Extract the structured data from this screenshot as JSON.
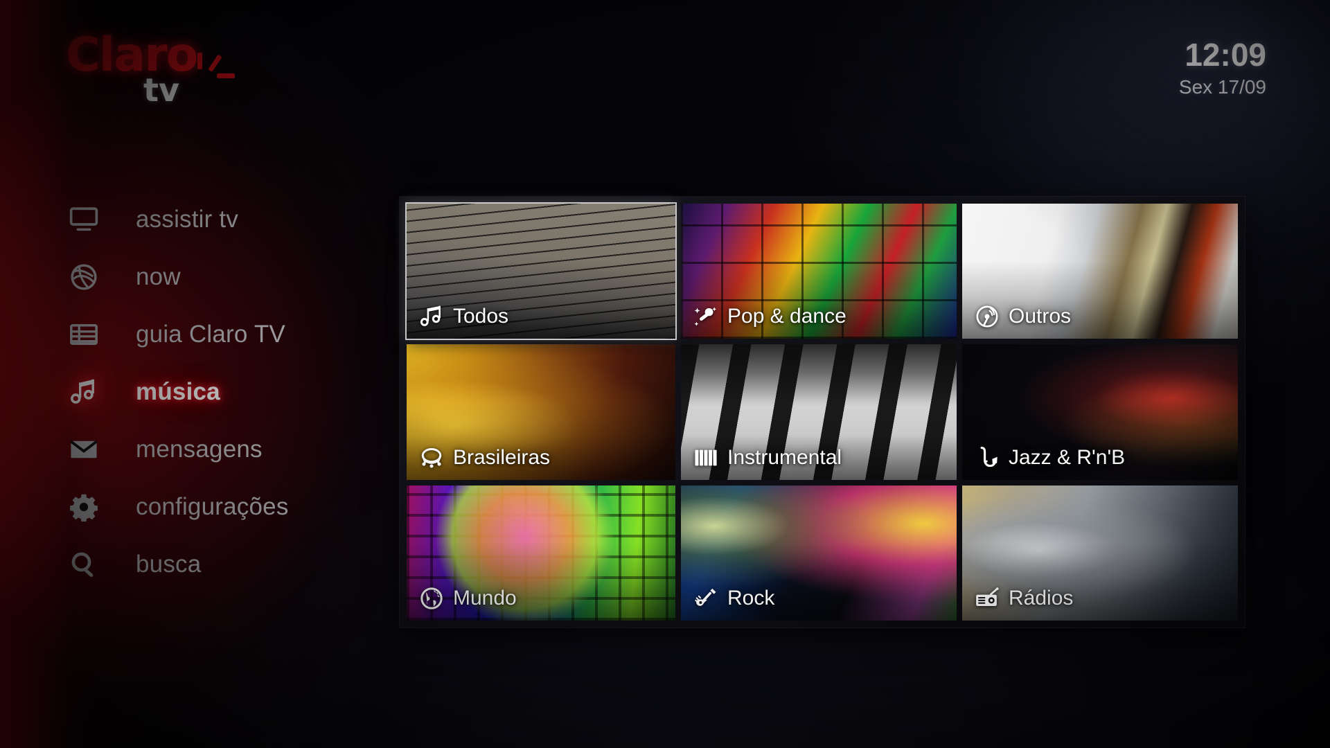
{
  "brand": {
    "name": "Claro",
    "suffix": "tv",
    "accent_color": "#e01118"
  },
  "clock": {
    "time": "12:09",
    "date": "Sex 17/09"
  },
  "sidebar": {
    "items": [
      {
        "id": "assistir-tv",
        "label": "assistir tv",
        "icon": "monitor-icon",
        "active": false
      },
      {
        "id": "now",
        "label": "now",
        "icon": "globe-mesh-icon",
        "active": false
      },
      {
        "id": "guia-claro-tv",
        "label": "guia Claro TV",
        "icon": "grid-list-icon",
        "active": false
      },
      {
        "id": "musica",
        "label": "música",
        "icon": "music-note-icon",
        "active": true
      },
      {
        "id": "mensagens",
        "label": "mensagens",
        "icon": "envelope-icon",
        "active": false
      },
      {
        "id": "configuracoes",
        "label": "configurações",
        "icon": "gear-icon",
        "active": false
      },
      {
        "id": "busca",
        "label": "busca",
        "icon": "search-icon",
        "active": false
      }
    ]
  },
  "grid": {
    "tiles": [
      {
        "id": "todos",
        "label": "Todos",
        "icon": "double-music-note-icon",
        "art": "art-todos",
        "selected": true
      },
      {
        "id": "pop-dance",
        "label": "Pop & dance",
        "icon": "sparkle-mic-icon",
        "art": "art-pop",
        "selected": false
      },
      {
        "id": "outros",
        "label": "Outros",
        "icon": "vinyl-record-icon",
        "art": "art-outros",
        "selected": false
      },
      {
        "id": "brasileiras",
        "label": "Brasileiras",
        "icon": "tambourine-icon",
        "art": "art-bras",
        "selected": false
      },
      {
        "id": "instrumental",
        "label": "Instrumental",
        "icon": "piano-keys-icon",
        "art": "art-instr",
        "selected": false
      },
      {
        "id": "jazz-rnb",
        "label": "Jazz & R'n'B",
        "icon": "saxophone-icon",
        "art": "art-jazz",
        "selected": false
      },
      {
        "id": "mundo",
        "label": "Mundo",
        "icon": "globe-icon",
        "art": "art-mundo",
        "selected": false
      },
      {
        "id": "rock",
        "label": "Rock",
        "icon": "electric-guitar-icon",
        "art": "art-rock",
        "selected": false
      },
      {
        "id": "radios",
        "label": "Rádios",
        "icon": "radio-icon",
        "art": "art-radios",
        "selected": false
      }
    ]
  }
}
